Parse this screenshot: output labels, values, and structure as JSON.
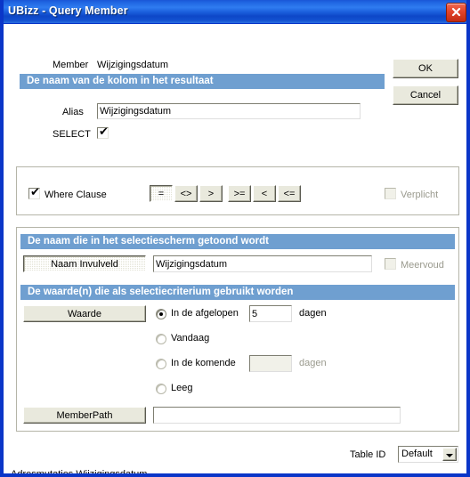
{
  "window": {
    "title": "UBizz - Query Member",
    "close_icon": "close-x-icon"
  },
  "buttons": {
    "ok": "OK",
    "cancel": "Cancel"
  },
  "member": {
    "label": "Member",
    "value": "Wijzigingsdatum"
  },
  "section_alias": {
    "header": "De naam van de kolom in het resultaat",
    "alias_label": "Alias",
    "alias_value": "Wijzigingsdatum",
    "select_label": "SELECT",
    "select_checked": "✔"
  },
  "section_where": {
    "where_label": "Where Clause",
    "where_checked": "✔",
    "operators": [
      {
        "label": "=",
        "pressed": true
      },
      {
        "label": "<>",
        "pressed": false
      },
      {
        "label": ">",
        "pressed": false
      },
      {
        "label": ">=",
        "pressed": false
      },
      {
        "label": "<",
        "pressed": false
      },
      {
        "label": "<=",
        "pressed": false
      }
    ],
    "verplicht_label": "Verplicht"
  },
  "section_name": {
    "header": "De naam die in het selectiescherm getoond wordt",
    "button_label": "Naam Invulveld",
    "field_value": "Wijzigingsdatum",
    "meervoud_label": "Meervoud"
  },
  "section_value": {
    "header": "De waarde(n) die als selectiecriterium gebruikt worden",
    "button_label": "Waarde",
    "options": [
      {
        "label": "In de afgelopen",
        "selected": true,
        "field": "5",
        "suffix": "dagen",
        "suffix_dim": false,
        "has_field": true,
        "field_disabled": false
      },
      {
        "label": "Vandaag",
        "selected": false,
        "field": "",
        "suffix": "",
        "suffix_dim": false,
        "has_field": false,
        "field_disabled": false
      },
      {
        "label": "In de komende",
        "selected": false,
        "field": "",
        "suffix": "dagen",
        "suffix_dim": true,
        "has_field": true,
        "field_disabled": true
      },
      {
        "label": "Leeg",
        "selected": false,
        "field": "",
        "suffix": "",
        "suffix_dim": false,
        "has_field": false,
        "field_disabled": false
      }
    ],
    "memberpath_label": "MemberPath",
    "memberpath_value": ""
  },
  "table_id": {
    "label": "Table ID",
    "value": "Default",
    "options": [
      "Default"
    ]
  },
  "status": {
    "text": "Adresmutaties.Wijzigingsdatum"
  },
  "colors": {
    "titlebar_blue": "#1b5fdc",
    "section_header_blue": "#6f9fd0",
    "window_border": "#0a36c8",
    "close_red": "#c32c12",
    "button_face": "#e9e9dd"
  }
}
